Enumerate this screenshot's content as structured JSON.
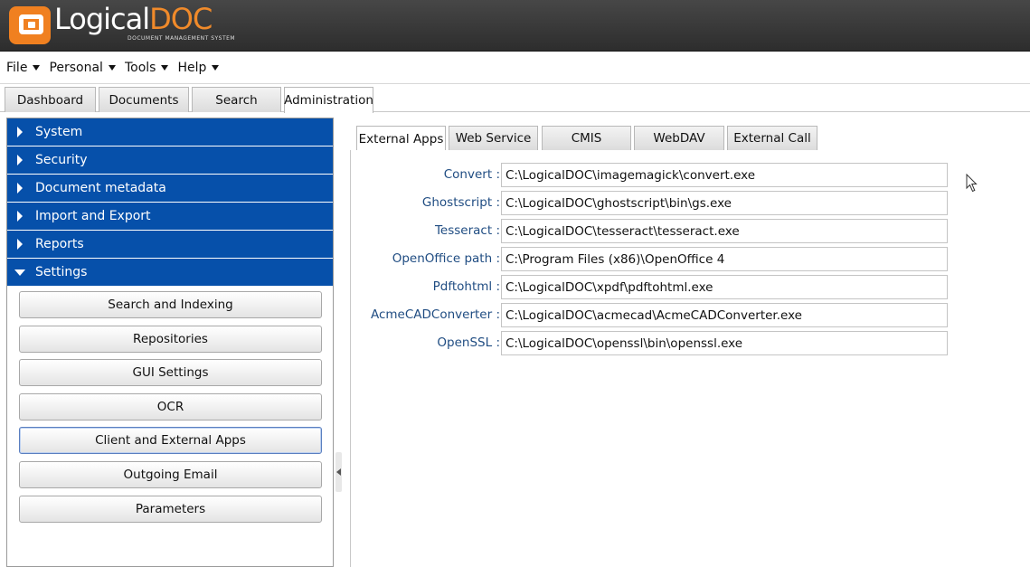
{
  "app": {
    "logo_main": "Logical",
    "logo_accent": "DOC",
    "logo_sub": "DOCUMENT MANAGEMENT SYSTEM"
  },
  "menubar": {
    "items": [
      "File",
      "Personal",
      "Tools",
      "Help"
    ]
  },
  "main_tabs": {
    "items": [
      "Dashboard",
      "Documents",
      "Search",
      "Administration"
    ],
    "active": "Administration"
  },
  "sidebar": {
    "sections": [
      "System",
      "Security",
      "Document metadata",
      "Import and Export",
      "Reports",
      "Settings"
    ],
    "expanded": "Settings",
    "settings_items": [
      "Search and Indexing",
      "Repositories",
      "GUI Settings",
      "OCR",
      "Client and External Apps",
      "Outgoing Email",
      "Parameters"
    ],
    "selected": "Client and External Apps"
  },
  "sub_tabs": {
    "items": [
      "External Apps",
      "Web Service",
      "CMIS",
      "WebDAV",
      "External Call"
    ],
    "active": "External Apps"
  },
  "form": {
    "fields": [
      {
        "label": "Convert",
        "value": "C:\\LogicalDOC\\imagemagick\\convert.exe"
      },
      {
        "label": "Ghostscript",
        "value": "C:\\LogicalDOC\\ghostscript\\bin\\gs.exe"
      },
      {
        "label": "Tesseract",
        "value": "C:\\LogicalDOC\\tesseract\\tesseract.exe"
      },
      {
        "label": "OpenOffice path",
        "value": "C:\\Program Files (x86)\\OpenOffice 4"
      },
      {
        "label": "Pdftohtml",
        "value": "C:\\LogicalDOC\\xpdf\\pdftohtml.exe"
      },
      {
        "label": "AcmeCADConverter",
        "value": "C:\\LogicalDOC\\acmecad\\AcmeCADConverter.exe"
      },
      {
        "label": "OpenSSL",
        "value": "C:\\LogicalDOC\\openssl\\bin\\openssl.exe"
      }
    ],
    "separator": ":"
  },
  "colors": {
    "nav_blue": "#0650aa",
    "label_blue": "#1f4c82",
    "logo_orange": "#f08020"
  }
}
